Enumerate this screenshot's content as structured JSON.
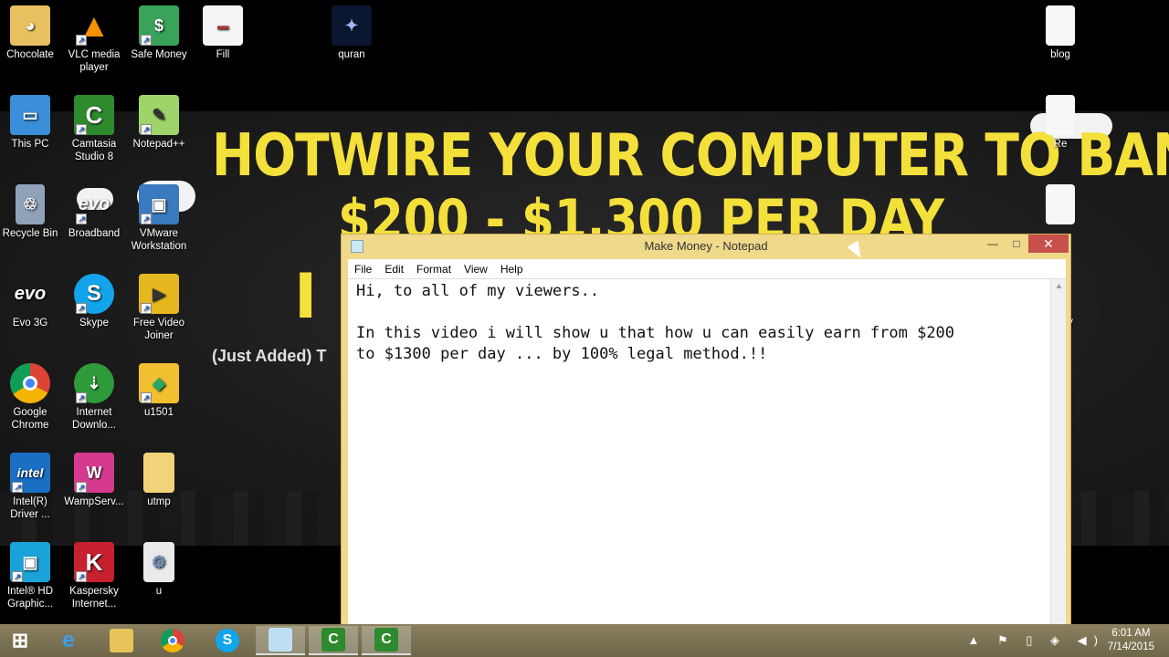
{
  "wallpaper": {
    "headline_line1": "HOTWIRE YOUR COMPUTER TO BANK",
    "headline_line2": "$200 - $1,300 PER DAY",
    "headline_fragment": "I S",
    "subtext": "(Just Added) T",
    "accent_color": "#f4e03b"
  },
  "desktop_icons": [
    {
      "label": "Chocolate",
      "icon": "user-folder-icon"
    },
    {
      "label": "VLC media player",
      "icon": "vlc-icon"
    },
    {
      "label": "Safe Money",
      "icon": "money-icon"
    },
    {
      "label": "Fill",
      "icon": "document-icon"
    },
    {
      "label": "quran",
      "icon": "image-icon"
    },
    {
      "label": "blog",
      "icon": "file-icon"
    },
    {
      "label": "This PC",
      "icon": "computer-icon"
    },
    {
      "label": "Camtasia Studio 8",
      "icon": "camtasia-icon"
    },
    {
      "label": "Notepad++",
      "icon": "notepadpp-icon"
    },
    {
      "label": "Re",
      "icon": "file-icon"
    },
    {
      "label": "Recycle Bin",
      "icon": "recycle-bin-icon"
    },
    {
      "label": "Broadband",
      "icon": "evo-icon"
    },
    {
      "label": "VMware Workstation",
      "icon": "vmware-icon"
    },
    {
      "label": "Evo 3G",
      "icon": "evo-icon"
    },
    {
      "label": "Skype",
      "icon": "skype-icon"
    },
    {
      "label": "Free Video Joiner",
      "icon": "video-joiner-icon"
    },
    {
      "label": "oney",
      "icon": "file-icon"
    },
    {
      "label": "Google Chrome",
      "icon": "chrome-icon"
    },
    {
      "label": "Internet Downlo...",
      "icon": "idm-icon"
    },
    {
      "label": "u1501",
      "icon": "setup-icon"
    },
    {
      "label": "Intel(R) Driver ...",
      "icon": "intel-icon"
    },
    {
      "label": "WampServ...",
      "icon": "wamp-icon"
    },
    {
      "label": "utmp",
      "icon": "folder-icon"
    },
    {
      "label": "Intel® HD Graphic...",
      "icon": "intel-hd-icon"
    },
    {
      "label": "Kaspersky Internet...",
      "icon": "kaspersky-icon"
    },
    {
      "label": "u",
      "icon": "settings-file-icon"
    }
  ],
  "notepad": {
    "title": "Make Money - Notepad",
    "menu": [
      "File",
      "Edit",
      "Format",
      "View",
      "Help"
    ],
    "content": "Hi, to all of my viewers..\n\nIn this video i will show u that how u can easily earn from $200\nto $1300 per day ... by 100% legal method.!!",
    "buttons": {
      "minimize": "—",
      "maximize": "□",
      "close": "✕"
    }
  },
  "taskbar": {
    "items": [
      "start-button",
      "internet-explorer",
      "file-explorer",
      "google-chrome",
      "skype",
      "notepad",
      "camtasia-recorder",
      "camtasia-studio"
    ],
    "tray_icons": [
      "show-hidden-icon",
      "action-center-icon",
      "power-icon",
      "network-icon",
      "volume-icon"
    ],
    "tray_glyphs": "▲ ⚑ ▯ ◈ ◀)",
    "time": "6:01 AM",
    "date": "7/14/2015"
  }
}
